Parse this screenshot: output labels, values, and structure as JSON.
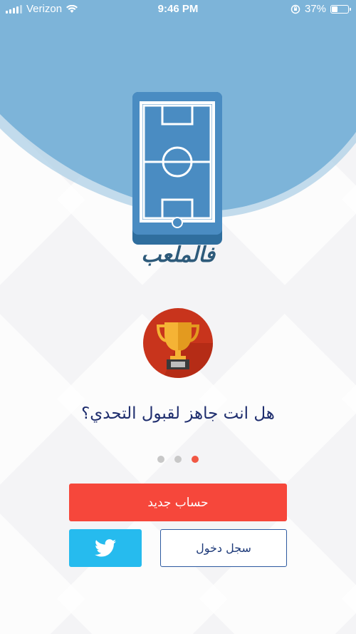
{
  "status_bar": {
    "carrier": "Verizon",
    "time": "9:46 PM",
    "battery": "37%",
    "battery_level": 0.37,
    "icons": [
      "signal-icon",
      "wifi-icon",
      "orientation-lock-icon",
      "battery-icon"
    ]
  },
  "app": {
    "logo_text": "فالملعب"
  },
  "onboarding": {
    "headline": "هل انت جاهز لقبول التحدي؟",
    "page_count": 3,
    "active_page": 3
  },
  "actions": {
    "signup_label": "حساب جديد",
    "login_label": "سجل دخول",
    "twitter_icon": "twitter-icon"
  },
  "colors": {
    "header_blue": "#7db4d9",
    "primary_red": "#f6473b",
    "twitter_blue": "#26bbee",
    "headline_navy": "#1f2e6e",
    "trophy_red": "#c8341c",
    "trophy_gold": "#f5b335"
  }
}
